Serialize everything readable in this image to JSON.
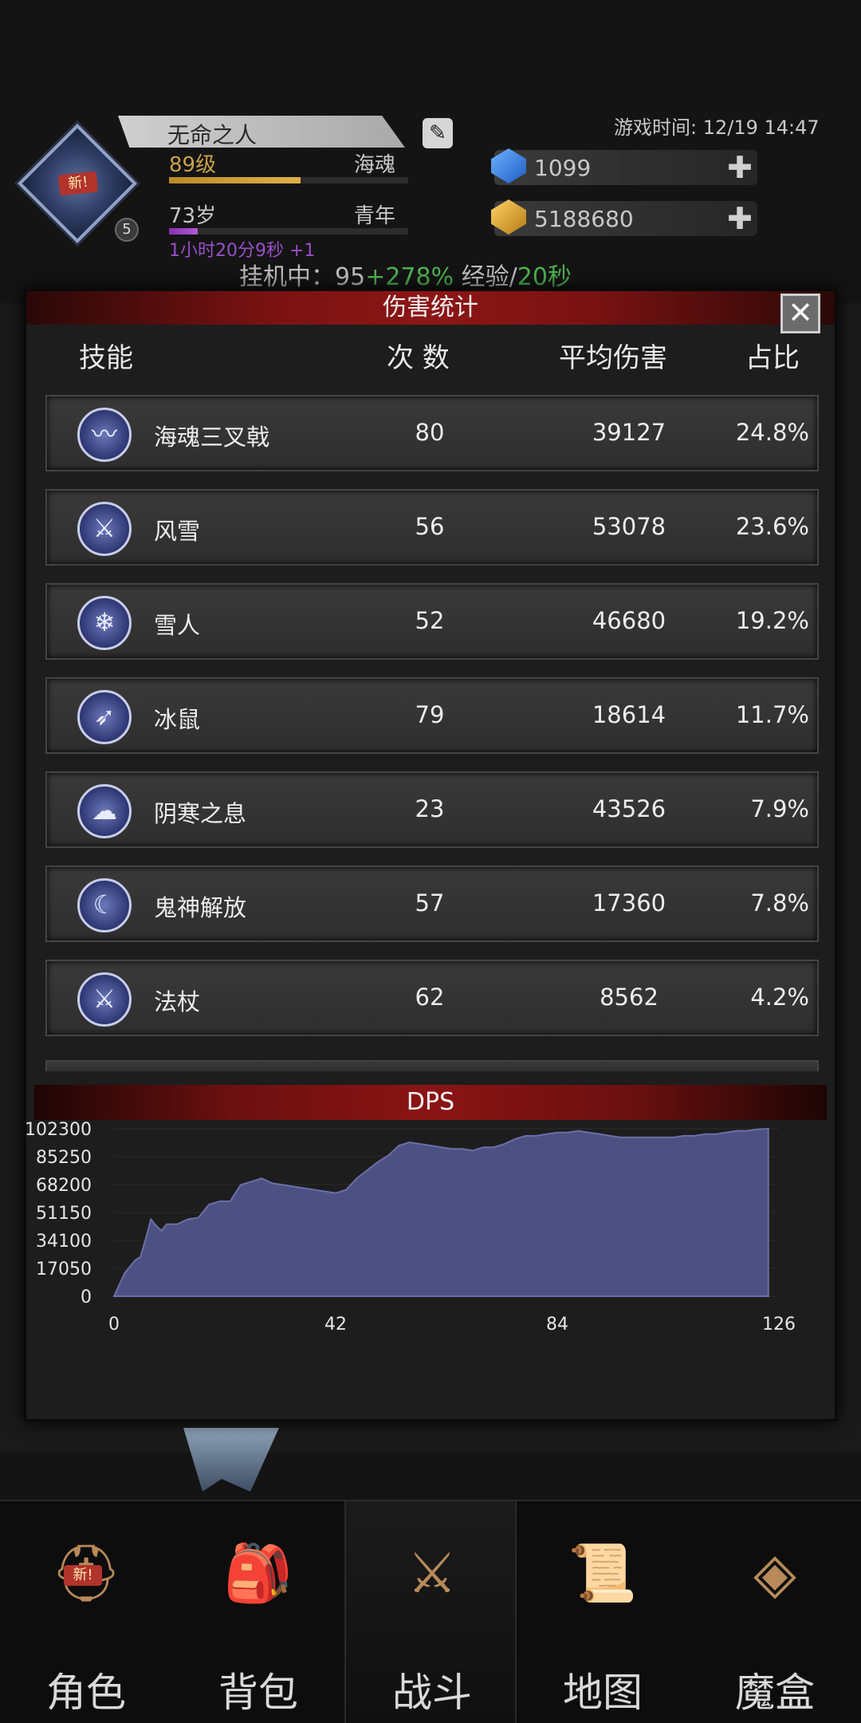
{
  "header": {
    "player_name": "无命之人",
    "level": "89级",
    "class": "海魂",
    "level_progress": 0.55,
    "age": "73岁",
    "life_stage": "青年",
    "age_progress": 0.12,
    "timer": "1小时20分9秒 +1",
    "avatar_new": "新!",
    "avatar_badge": "5",
    "game_time": "游戏时间: 12/19 14:47",
    "gems": "1099",
    "gold": "5188680",
    "plus": "✚",
    "afk_prefix": "挂机中：",
    "afk_value": "95",
    "afk_bonus": "+278%",
    "afk_middle": " 经验/",
    "afk_rate": "20秒"
  },
  "modal": {
    "title": "伤害统计",
    "close": "✕",
    "headers": {
      "skill": "技能",
      "count": "次 数",
      "avg": "平均伤害",
      "pct": "占比"
    },
    "rows": [
      {
        "name": "海魂三叉戟",
        "count": "80",
        "avg": "39127",
        "pct": "24.8%",
        "icon": "wave-icon",
        "glyph": "〰"
      },
      {
        "name": "风雪",
        "count": "56",
        "avg": "53078",
        "pct": "23.6%",
        "icon": "sword-icon",
        "glyph": "⚔"
      },
      {
        "name": "雪人",
        "count": "52",
        "avg": "46680",
        "pct": "19.2%",
        "icon": "ice-spikes-icon",
        "glyph": "❄"
      },
      {
        "name": "冰鼠",
        "count": "79",
        "avg": "18614",
        "pct": "11.7%",
        "icon": "arrows-icon",
        "glyph": "➶"
      },
      {
        "name": "阴寒之息",
        "count": "23",
        "avg": "43526",
        "pct": "7.9%",
        "icon": "breath-icon",
        "glyph": "☁"
      },
      {
        "name": "鬼神解放",
        "count": "57",
        "avg": "17360",
        "pct": "7.8%",
        "icon": "slash-icon",
        "glyph": "☾"
      },
      {
        "name": "法杖",
        "count": "62",
        "avg": "8562",
        "pct": "4.2%",
        "icon": "staff-icon",
        "glyph": "⚔"
      }
    ],
    "dps_title": "DPS"
  },
  "chart_data": {
    "type": "area",
    "title": "DPS",
    "xlabel": "",
    "ylabel": "",
    "x_ticks": [
      "0",
      "42",
      "84",
      "126"
    ],
    "y_ticks": [
      "0",
      "17050",
      "34100",
      "51150",
      "68200",
      "85250",
      "102300"
    ],
    "xlim": [
      0,
      126
    ],
    "ylim": [
      0,
      102300
    ],
    "fill_color": "#4d5182",
    "line_color": "#6a6fa8",
    "x": [
      0,
      2,
      4,
      5,
      6,
      7,
      8,
      9,
      10,
      12,
      14,
      16,
      18,
      20,
      22,
      24,
      26,
      28,
      30,
      32,
      34,
      36,
      38,
      40,
      42,
      44,
      46,
      48,
      50,
      52,
      54,
      56,
      58,
      60,
      62,
      64,
      66,
      68,
      70,
      72,
      74,
      76,
      78,
      80,
      82,
      84,
      86,
      88,
      90,
      92,
      94,
      96,
      98,
      100,
      102,
      104,
      106,
      108,
      110,
      112,
      114,
      116,
      118,
      120,
      122,
      124
    ],
    "values": [
      0,
      14000,
      22000,
      24000,
      35000,
      47000,
      43000,
      40000,
      44000,
      44000,
      47000,
      48000,
      56000,
      58000,
      58000,
      68000,
      70000,
      72000,
      69000,
      68000,
      67000,
      66000,
      65000,
      64000,
      63000,
      65000,
      72000,
      77000,
      82000,
      86000,
      92000,
      94000,
      93000,
      92000,
      91000,
      90000,
      90000,
      89000,
      91000,
      91000,
      93000,
      96000,
      98000,
      98000,
      99000,
      100000,
      100000,
      101000,
      100000,
      99000,
      98000,
      97000,
      97000,
      97000,
      97000,
      97000,
      97000,
      98000,
      98000,
      99000,
      99000,
      100000,
      101000,
      101000,
      102000,
      102300
    ]
  },
  "nav": {
    "items": [
      {
        "label": "角色",
        "glyph": "⛑",
        "icon": "helmet-icon",
        "new": "新!"
      },
      {
        "label": "背包",
        "glyph": "🎒",
        "icon": "backpack-icon"
      },
      {
        "label": "战斗",
        "glyph": "⚔",
        "icon": "shield-sword-icon"
      },
      {
        "label": "地图",
        "glyph": "📜",
        "icon": "scroll-map-icon"
      },
      {
        "label": "魔盒",
        "glyph": "◈",
        "icon": "magic-box-icon"
      }
    ]
  }
}
